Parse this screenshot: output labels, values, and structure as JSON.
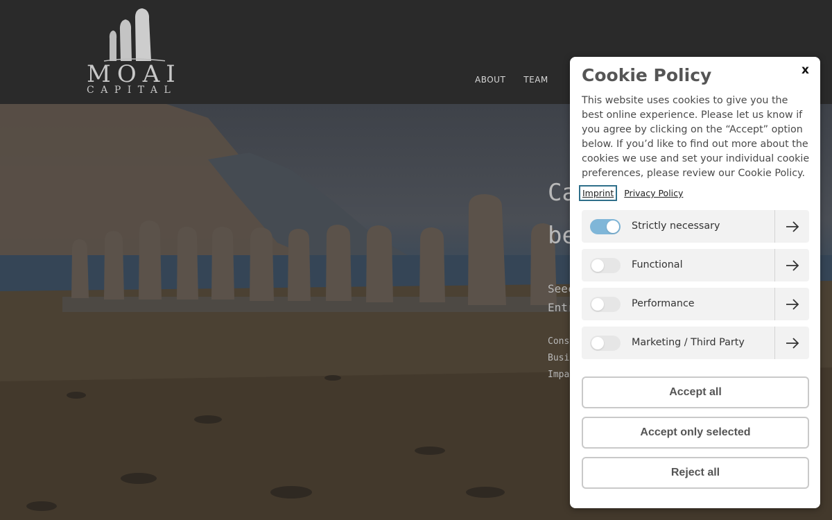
{
  "header": {
    "logo_word": "MOAI",
    "logo_sub": "CAPITAL",
    "nav": [
      "ABOUT",
      "TEAM"
    ]
  },
  "hero": {
    "title_1": "Ca",
    "title_2": "be",
    "sub_1": "Seec",
    "sub_2": "Entr",
    "item_1": "Cons",
    "item_2": "Busi",
    "item_3": "Impa"
  },
  "cookie": {
    "close_label": "x",
    "title": "Cookie Policy",
    "text": "This website uses cookies to give you the best online experience. Please let us know if you agree by clicking on the “Accept” option below. If you’d like to find out more about the cookies we use and set your individual cookie preferences, please review our Cookie Policy.",
    "links": {
      "imprint": "Imprint",
      "privacy": "Privacy Policy"
    },
    "toggles": [
      {
        "label": "Strictly necessary",
        "enabled": true
      },
      {
        "label": "Functional",
        "enabled": false
      },
      {
        "label": "Performance",
        "enabled": false
      },
      {
        "label": "Marketing / Third Party",
        "enabled": false
      }
    ],
    "buttons": {
      "accept_all": "Accept all",
      "accept_selected": "Accept only selected",
      "reject_all": "Reject all"
    },
    "colors": {
      "toggle_on": "#7fb6d8",
      "focus_ring": "#2e6f8a"
    }
  },
  "icons": {
    "toggle_arrow": "arrow-right-icon",
    "logo": "moai-statues-icon"
  }
}
